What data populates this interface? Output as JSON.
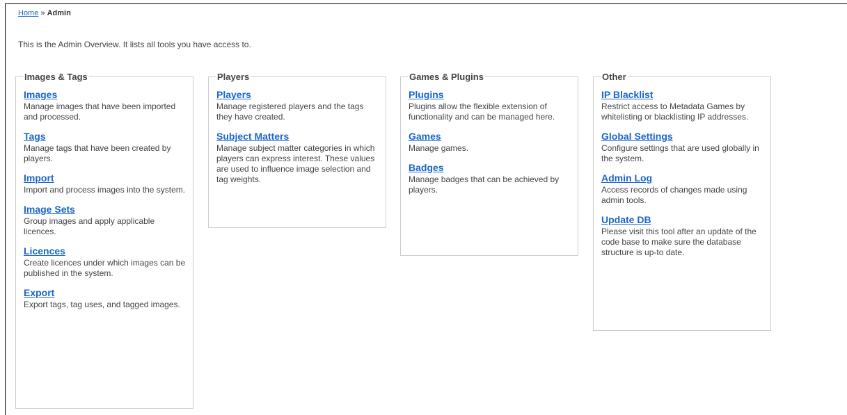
{
  "breadcrumb": {
    "home": "Home",
    "separator": "»",
    "current": "Admin"
  },
  "intro": "This is the Admin Overview. It lists all tools you have access to.",
  "groups": [
    {
      "title": "Images & Tags",
      "tools": [
        {
          "label": "Images",
          "desc": "Manage images that have been imported and processed."
        },
        {
          "label": "Tags",
          "desc": "Manage tags that have been created by players."
        },
        {
          "label": "Import",
          "desc": "Import and process images into the system."
        },
        {
          "label": "Image Sets",
          "desc": "Group images and apply applicable licences."
        },
        {
          "label": "Licences",
          "desc": "Create licences under which images can be published in the system."
        },
        {
          "label": "Export",
          "desc": "Export tags, tag uses, and tagged images."
        }
      ]
    },
    {
      "title": "Players",
      "tools": [
        {
          "label": "Players",
          "desc": "Manage registered players and the tags they have created."
        },
        {
          "label": "Subject Matters",
          "desc": "Manage subject matter categories in which players can express interest. These values are used to influence image selection and tag weights."
        }
      ]
    },
    {
      "title": "Games & Plugins",
      "tools": [
        {
          "label": "Plugins",
          "desc": "Plugins allow the flexible extension of functionality and can be managed here."
        },
        {
          "label": "Games",
          "desc": "Manage games."
        },
        {
          "label": "Badges",
          "desc": "Manage badges that can be achieved by players."
        }
      ]
    },
    {
      "title": "Other",
      "tools": [
        {
          "label": "IP Blacklist",
          "desc": "Restrict access to Metadata Games by whitelisting or blacklisting IP addresses."
        },
        {
          "label": "Global Settings",
          "desc": "Configure settings that are used globally in the system."
        },
        {
          "label": "Admin Log",
          "desc": "Access records of changes made using admin tools."
        },
        {
          "label": "Update DB",
          "desc": "Please visit this tool after an update of the code base to make sure the database structure is up-to date."
        }
      ]
    }
  ]
}
